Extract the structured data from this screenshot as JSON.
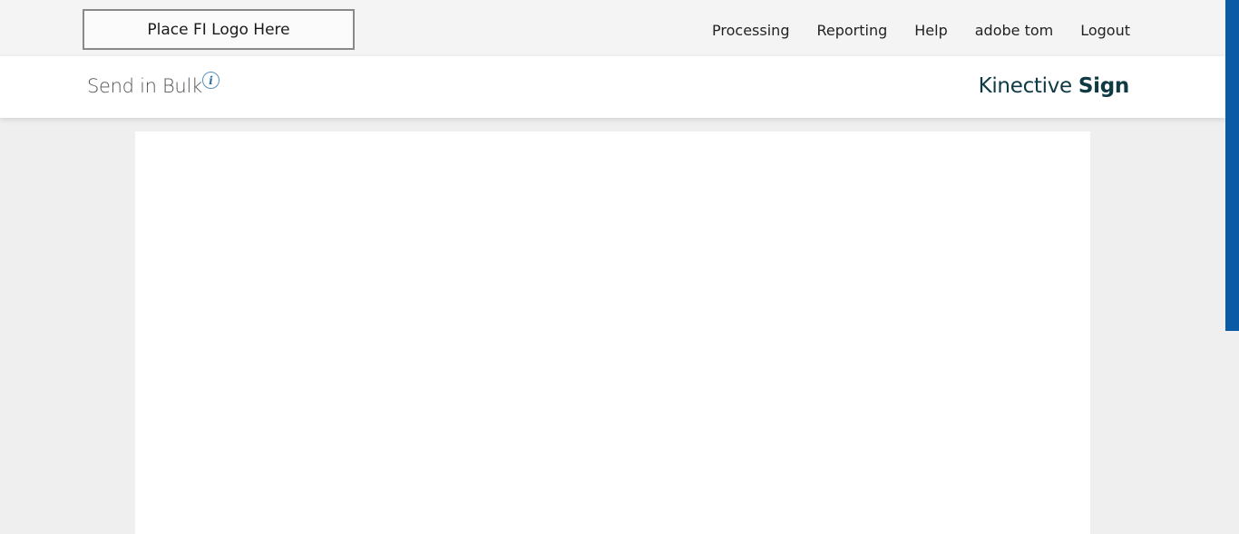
{
  "header": {
    "logo_placeholder": "Place FI Logo Here",
    "nav": [
      {
        "label": "Processing"
      },
      {
        "label": "Reporting"
      },
      {
        "label": "Help"
      },
      {
        "label": "adobe tom"
      },
      {
        "label": "Logout"
      }
    ]
  },
  "subheader": {
    "title": "Send in Bulk",
    "info_glyph": "i",
    "brand_light": "Kinective",
    "brand_bold": "Sign"
  },
  "colors": {
    "brand": "#0f3a44",
    "accent": "#0b5aa6",
    "info": "#2a6ea6"
  }
}
